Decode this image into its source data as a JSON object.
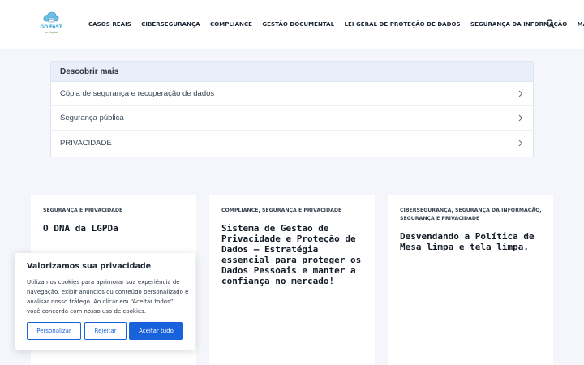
{
  "header": {
    "logo": {
      "name": "GO FAST",
      "tagline": "be digital",
      "cloud_color": "#6cc0e8"
    },
    "nav": [
      {
        "label": "CASOS REAIS"
      },
      {
        "label": "CIBERSEGURANÇA"
      },
      {
        "label": "COMPLIANCE"
      },
      {
        "label": "GESTÃO DOCUMENTAL"
      },
      {
        "label": "LEI GERAL DE PROTEÇÃO DE DADOS"
      },
      {
        "label": "SEGURANÇA DA INFORMAÇÃO"
      }
    ],
    "more_label": "MAIS",
    "more_icon": "chevron-down-icon",
    "search_icon": "search-icon"
  },
  "discover": {
    "title": "Descobrir mais",
    "items": [
      {
        "label": "Cópia de segurança e recuperação de dados"
      },
      {
        "label": "Segurança pública"
      },
      {
        "label": "PRIVACIDADE"
      }
    ],
    "item_icon": "chevron-right-icon"
  },
  "posts": [
    {
      "categories": "SEGURANÇA E PRIVACIDADE",
      "title": "O DNA da LGPDa"
    },
    {
      "categories": "COMPLIANCE, SEGURANÇA E PRIVACIDADE",
      "title": "Sistema de Gestão de Privacidade e Proteção de Dados – Estratégia essencial para proteger os Dados Pessoais e manter a confiança no mercado!"
    },
    {
      "categories": "CIBERSEGURANÇA, SEGURANÇA DA INFORMAÇÃO, SEGURANÇA E PRIVACIDADE",
      "title": "Desvendando a Política de Mesa limpa e tela limpa."
    }
  ],
  "cookie_banner": {
    "title": "Valorizamos sua privacidade",
    "text": "Utilizamos cookies para aprimorar sua experiência de navegação, exibir anúncios ou conteúdo personalizado e analisar nosso tráfego. Ao clicar em “Aceitar todos”, você concorda com nosso uso de cookies.",
    "customize_label": "Personalizar",
    "reject_label": "Rejeitar",
    "accept_label": "Aceitar tudo",
    "accent_color": "#1863dc"
  },
  "colors": {
    "page_background": "#f4f6fb",
    "discover_header_background": "#e9eef8"
  }
}
